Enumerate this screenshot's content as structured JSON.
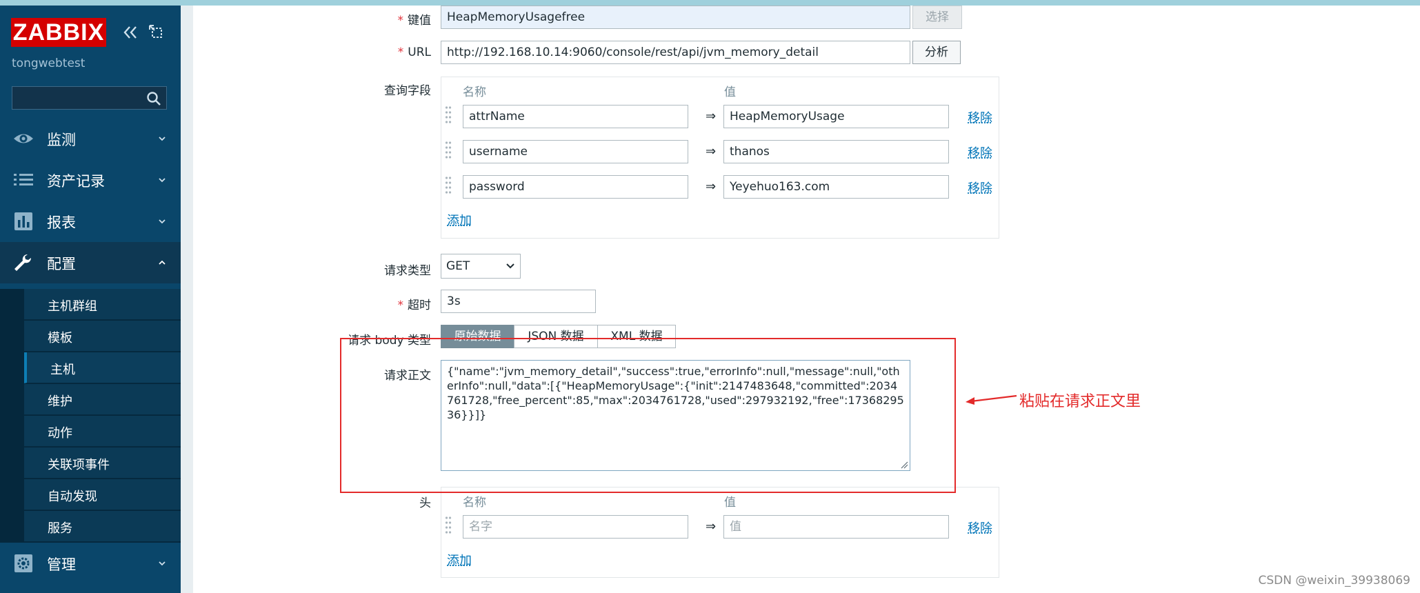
{
  "app": {
    "logo_text": "ZABBIX",
    "host": "tongwebtest"
  },
  "search": {
    "placeholder": ""
  },
  "menu": {
    "items": [
      {
        "label": "监测",
        "icon": "eye-icon"
      },
      {
        "label": "资产记录",
        "icon": "list-icon"
      },
      {
        "label": "报表",
        "icon": "bar-chart-icon"
      },
      {
        "label": "配置",
        "icon": "wrench-icon"
      },
      {
        "label": "管理",
        "icon": "gear-icon"
      }
    ],
    "submenu": [
      "主机群组",
      "模板",
      "主机",
      "维护",
      "动作",
      "关联项事件",
      "自动发现",
      "服务"
    ]
  },
  "form": {
    "key_label": "键值",
    "key_value": "HeapMemoryUsagefree",
    "key_button": "选择",
    "url_label": "URL",
    "url_value": "http://192.168.10.14:9060/console/rest/api/jvm_memory_detail",
    "url_button": "分析",
    "query_label": "查询字段",
    "col_name": "名称",
    "col_value": "值",
    "query_fields": [
      {
        "name": "attrName",
        "value": "HeapMemoryUsage"
      },
      {
        "name": "username",
        "value": "thanos"
      },
      {
        "name": "password",
        "value": "Yeyehuo163.com"
      }
    ],
    "arrow": "⇒",
    "remove_link": "移除",
    "add_link": "添加",
    "request_type_label": "请求类型",
    "request_type_value": "GET",
    "timeout_label": "超时",
    "timeout_value": "3s",
    "body_type_label": "请求 body 类型",
    "body_types": [
      "原始数据",
      "JSON 数据",
      "XML 数据"
    ],
    "body_label": "请求正文",
    "body_value": "{\"name\":\"jvm_memory_detail\",\"success\":true,\"errorInfo\":null,\"message\":null,\"otherInfo\":null,\"data\":[{\"HeapMemoryUsage\":{\"init\":2147483648,\"committed\":2034761728,\"free_percent\":85,\"max\":2034761728,\"used\":297932192,\"free\":1736829536}}]}",
    "headers_label": "头",
    "header_name_placeholder": "名字",
    "header_value_placeholder": "值"
  },
  "annotation": {
    "text": "粘贴在请求正文里"
  },
  "watermark": "CSDN @weixin_39938069",
  "colors": {
    "sidebar": "#0a466a",
    "logo": "#d40000",
    "link": "#0275b8",
    "annotation": "#e32a2a"
  }
}
